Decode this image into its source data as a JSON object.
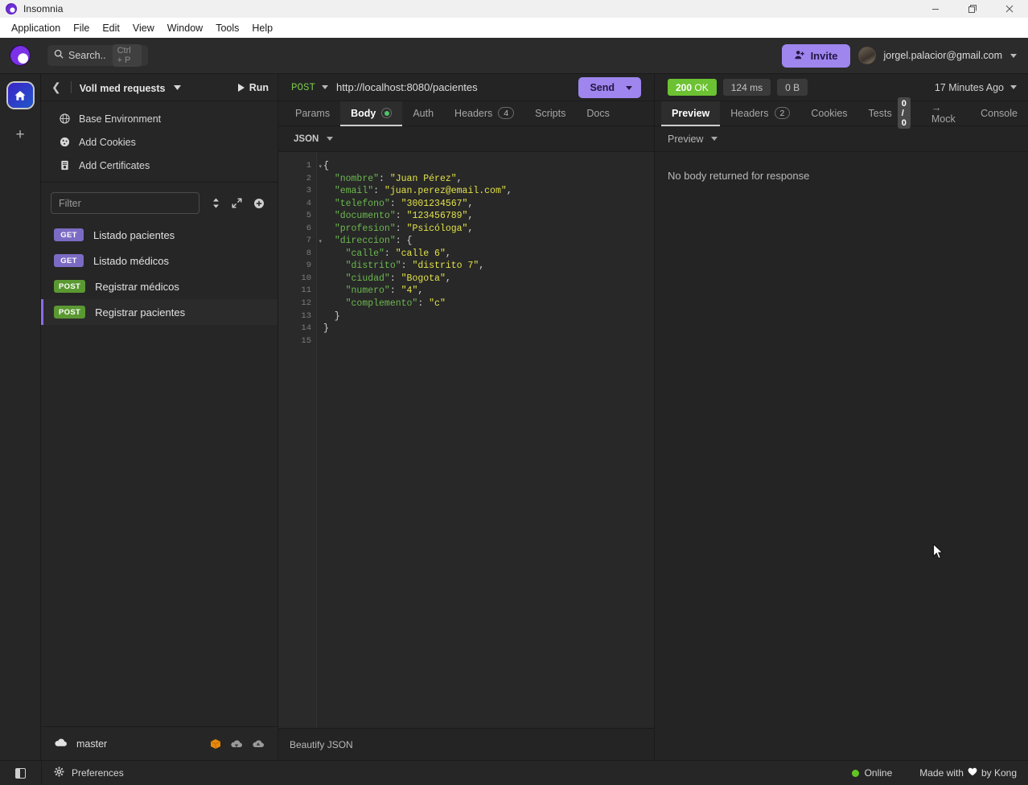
{
  "window": {
    "title": "Insomnia",
    "logo_icon": "insomnia-logo-icon",
    "controls": {
      "minimize": "minimize-icon",
      "maximize": "maximize-icon",
      "close": "close-icon"
    }
  },
  "menubar": {
    "items": [
      "Application",
      "File",
      "Edit",
      "View",
      "Window",
      "Tools",
      "Help"
    ]
  },
  "header": {
    "search": {
      "icon": "search-icon",
      "placeholder": "Search..",
      "shortcut": "Ctrl + P"
    },
    "invite_label": "Invite",
    "invite_icon": "user-plus-icon",
    "invite_color": "#9e86ee",
    "avatar": "avatar",
    "user_email": "jorgel.palacior@gmail.com"
  },
  "rail": {
    "workspace_icon": "home-icon",
    "add_icon": "plus-icon"
  },
  "sidebar": {
    "back_icon": "chevron-left-icon",
    "collection_title": "Voll med requests",
    "run_label": "Run",
    "run_icon": "play-icon",
    "links": [
      {
        "label": "Base Environment",
        "icon": "globe-icon"
      },
      {
        "label": "Add Cookies",
        "icon": "cookie-icon"
      },
      {
        "label": "Add Certificates",
        "icon": "certificate-icon"
      }
    ],
    "filter_placeholder": "Filter",
    "toolbar_icons": [
      "sort-icon",
      "expand-icon",
      "plus-circle-icon"
    ],
    "requests": [
      {
        "method": "GET",
        "name": "Listado pacientes",
        "active": false
      },
      {
        "method": "GET",
        "name": "Listado médicos",
        "active": false
      },
      {
        "method": "POST",
        "name": "Registrar médicos",
        "active": false
      },
      {
        "method": "POST",
        "name": "Registrar pacientes",
        "active": true
      }
    ],
    "footer": {
      "branch_icon": "cloud-icon",
      "branch": "master",
      "icons": [
        "package-icon",
        "cloud-download-icon",
        "cloud-upload-icon"
      ]
    },
    "method_colors": {
      "GET": "#7c6bc4",
      "POST": "#5a9932"
    }
  },
  "request": {
    "method": "POST",
    "method_color": "#79c44b",
    "url": "http://localhost:8080/pacientes",
    "send_label": "Send",
    "send_dropdown_icon": "chevron-down-icon",
    "tabs": [
      {
        "label": "Params",
        "active": false
      },
      {
        "label": "Body",
        "active": true,
        "badge_type": "dot"
      },
      {
        "label": "Auth",
        "active": false
      },
      {
        "label": "Headers",
        "active": false,
        "badge_type": "count",
        "badge": "4"
      },
      {
        "label": "Scripts",
        "active": false
      },
      {
        "label": "Docs",
        "active": false
      }
    ],
    "body_type": "JSON",
    "body_type_caret": "chevron-down-icon",
    "beautify_label": "Beautify JSON",
    "editor": {
      "line_count": 15,
      "fold_lines": [
        1,
        7
      ],
      "lines": [
        {
          "n": 1,
          "tokens": [
            {
              "t": "p",
              "s": "{"
            }
          ]
        },
        {
          "n": 2,
          "tokens": [
            {
              "t": "p",
              "s": "  "
            },
            {
              "t": "k",
              "s": "\"nombre\""
            },
            {
              "t": "p",
              "s": ": "
            },
            {
              "t": "v",
              "s": "\"Juan Pérez\""
            },
            {
              "t": "p",
              "s": ","
            }
          ]
        },
        {
          "n": 3,
          "tokens": [
            {
              "t": "p",
              "s": "  "
            },
            {
              "t": "k",
              "s": "\"email\""
            },
            {
              "t": "p",
              "s": ": "
            },
            {
              "t": "v",
              "s": "\"juan.perez@email.com\""
            },
            {
              "t": "p",
              "s": ","
            }
          ]
        },
        {
          "n": 4,
          "tokens": [
            {
              "t": "p",
              "s": "  "
            },
            {
              "t": "k",
              "s": "\"telefono\""
            },
            {
              "t": "p",
              "s": ": "
            },
            {
              "t": "v",
              "s": "\"3001234567\""
            },
            {
              "t": "p",
              "s": ","
            }
          ]
        },
        {
          "n": 5,
          "tokens": [
            {
              "t": "p",
              "s": "  "
            },
            {
              "t": "k",
              "s": "\"documento\""
            },
            {
              "t": "p",
              "s": ": "
            },
            {
              "t": "v",
              "s": "\"123456789\""
            },
            {
              "t": "p",
              "s": ","
            }
          ]
        },
        {
          "n": 6,
          "tokens": [
            {
              "t": "p",
              "s": "  "
            },
            {
              "t": "k",
              "s": "\"profesion\""
            },
            {
              "t": "p",
              "s": ": "
            },
            {
              "t": "v",
              "s": "\"Psicóloga\""
            },
            {
              "t": "p",
              "s": ","
            }
          ]
        },
        {
          "n": 7,
          "tokens": [
            {
              "t": "p",
              "s": "  "
            },
            {
              "t": "k",
              "s": "\"direccion\""
            },
            {
              "t": "p",
              "s": ": "
            },
            {
              "t": "p",
              "s": "{"
            }
          ]
        },
        {
          "n": 8,
          "tokens": [
            {
              "t": "p",
              "s": "    "
            },
            {
              "t": "k",
              "s": "\"calle\""
            },
            {
              "t": "p",
              "s": ": "
            },
            {
              "t": "v",
              "s": "\"calle 6\""
            },
            {
              "t": "p",
              "s": ","
            }
          ]
        },
        {
          "n": 9,
          "tokens": [
            {
              "t": "p",
              "s": "    "
            },
            {
              "t": "k",
              "s": "\"distrito\""
            },
            {
              "t": "p",
              "s": ": "
            },
            {
              "t": "v",
              "s": "\"distrito 7\""
            },
            {
              "t": "p",
              "s": ","
            }
          ]
        },
        {
          "n": 10,
          "tokens": [
            {
              "t": "p",
              "s": "    "
            },
            {
              "t": "k",
              "s": "\"ciudad\""
            },
            {
              "t": "p",
              "s": ": "
            },
            {
              "t": "v",
              "s": "\"Bogota\""
            },
            {
              "t": "p",
              "s": ","
            }
          ]
        },
        {
          "n": 11,
          "tokens": [
            {
              "t": "p",
              "s": "    "
            },
            {
              "t": "k",
              "s": "\"numero\""
            },
            {
              "t": "p",
              "s": ": "
            },
            {
              "t": "v",
              "s": "\"4\""
            },
            {
              "t": "p",
              "s": ","
            }
          ]
        },
        {
          "n": 12,
          "tokens": [
            {
              "t": "p",
              "s": "    "
            },
            {
              "t": "k",
              "s": "\"complemento\""
            },
            {
              "t": "p",
              "s": ": "
            },
            {
              "t": "v",
              "s": "\"c\""
            }
          ]
        },
        {
          "n": 13,
          "tokens": [
            {
              "t": "p",
              "s": "  }"
            }
          ]
        },
        {
          "n": 14,
          "tokens": [
            {
              "t": "p",
              "s": "}"
            }
          ]
        },
        {
          "n": 15,
          "tokens": []
        }
      ]
    }
  },
  "response": {
    "status_code": "200",
    "status_text": "OK",
    "status_color": "#6cc232",
    "time": "124 ms",
    "size": "0 B",
    "history_label": "17 Minutes Ago",
    "tabs": [
      {
        "label": "Preview",
        "active": true
      },
      {
        "label": "Headers",
        "active": false,
        "badge_type": "count",
        "badge": "2"
      },
      {
        "label": "Cookies",
        "active": false
      },
      {
        "label": "Tests",
        "active": false,
        "badge_type": "tests",
        "badge": "0 / 0"
      },
      {
        "label": "→ Mock",
        "active": false
      },
      {
        "label": "Console",
        "active": false
      }
    ],
    "view_mode": "Preview",
    "view_mode_caret": "chevron-down-icon",
    "body_message": "No body returned for response"
  },
  "statusbar": {
    "toggle_icon": "toggle-panel-icon",
    "preferences_label": "Preferences",
    "preferences_icon": "gear-icon",
    "online_label": "Online",
    "online_color": "#62c522",
    "credit_prefix": "Made with",
    "credit_heart": "heart-icon",
    "credit_suffix": "by Kong"
  }
}
